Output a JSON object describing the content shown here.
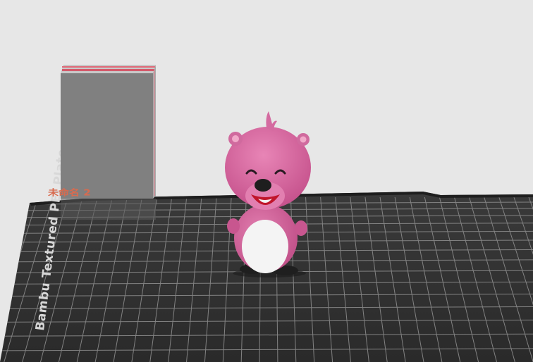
{
  "viewport": {
    "background": "#e7e7e7",
    "bed_color": "#2f2f2f",
    "grid_color": "#8c8c8c"
  },
  "bed_label": "Bambu Textured PEI Plate",
  "plate_tag": "未命名 2",
  "colors": {
    "wipe_tower_face": "#808080",
    "wipe_tower_side": "#aaaaaa",
    "wipe_tower_top_red": "#d45a6b",
    "model_pink": "#d96aa0",
    "model_belly": "#f4f4f4",
    "model_feet": "#1f1f1f",
    "mouth_red": "#c0152b"
  },
  "objects": [
    {
      "name": "wipe-tower"
    },
    {
      "name": "pink-beaver-figure"
    }
  ]
}
